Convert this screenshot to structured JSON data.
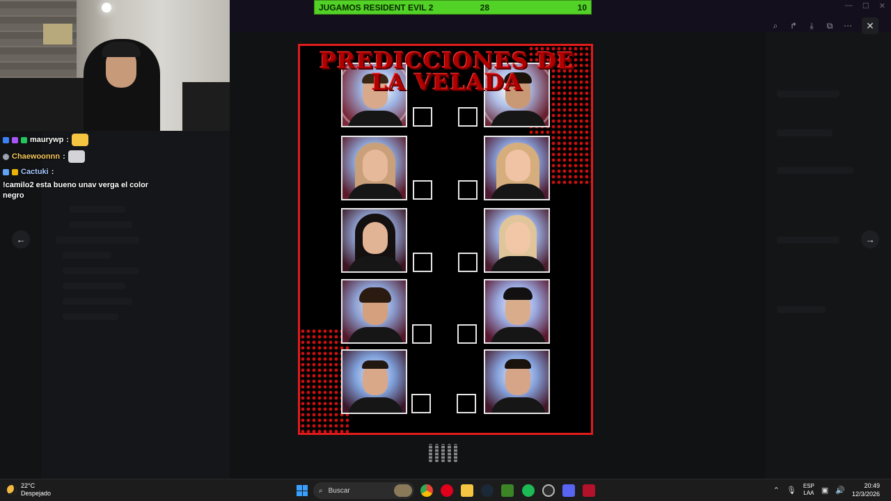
{
  "stream_banner": {
    "title": "JUGAMOS RESIDENT EVIL 2",
    "value_a": "28",
    "value_b": "10"
  },
  "chat": [
    {
      "user": "maurywp",
      "sep": " :",
      "message": ""
    },
    {
      "user": "Chaewoonnn",
      "sep": " :",
      "message": ""
    },
    {
      "user": "Cactuki",
      "sep": " : ",
      "message": "!camilo2 esta bueno unav verga el color negro"
    }
  ],
  "card": {
    "title": "PREDICCIONES DE LA VELADA"
  },
  "viewer": {
    "controls": [
      "zoom-icon",
      "forward-icon",
      "download-icon",
      "open-external-icon",
      "more-icon"
    ],
    "close_label": "✕",
    "prev_label": "←",
    "next_label": "→"
  },
  "taskbar": {
    "weather_temp": "22°C",
    "weather_desc": "Despejado",
    "search_placeholder": "Buscar",
    "lang_top": "ESP",
    "lang_bottom": "LAA",
    "time": "20:49",
    "date": "12/3/2026"
  },
  "colors": {
    "banner_green": "#52d126",
    "card_border": "#e21b1b",
    "title_red": "#b00000"
  }
}
